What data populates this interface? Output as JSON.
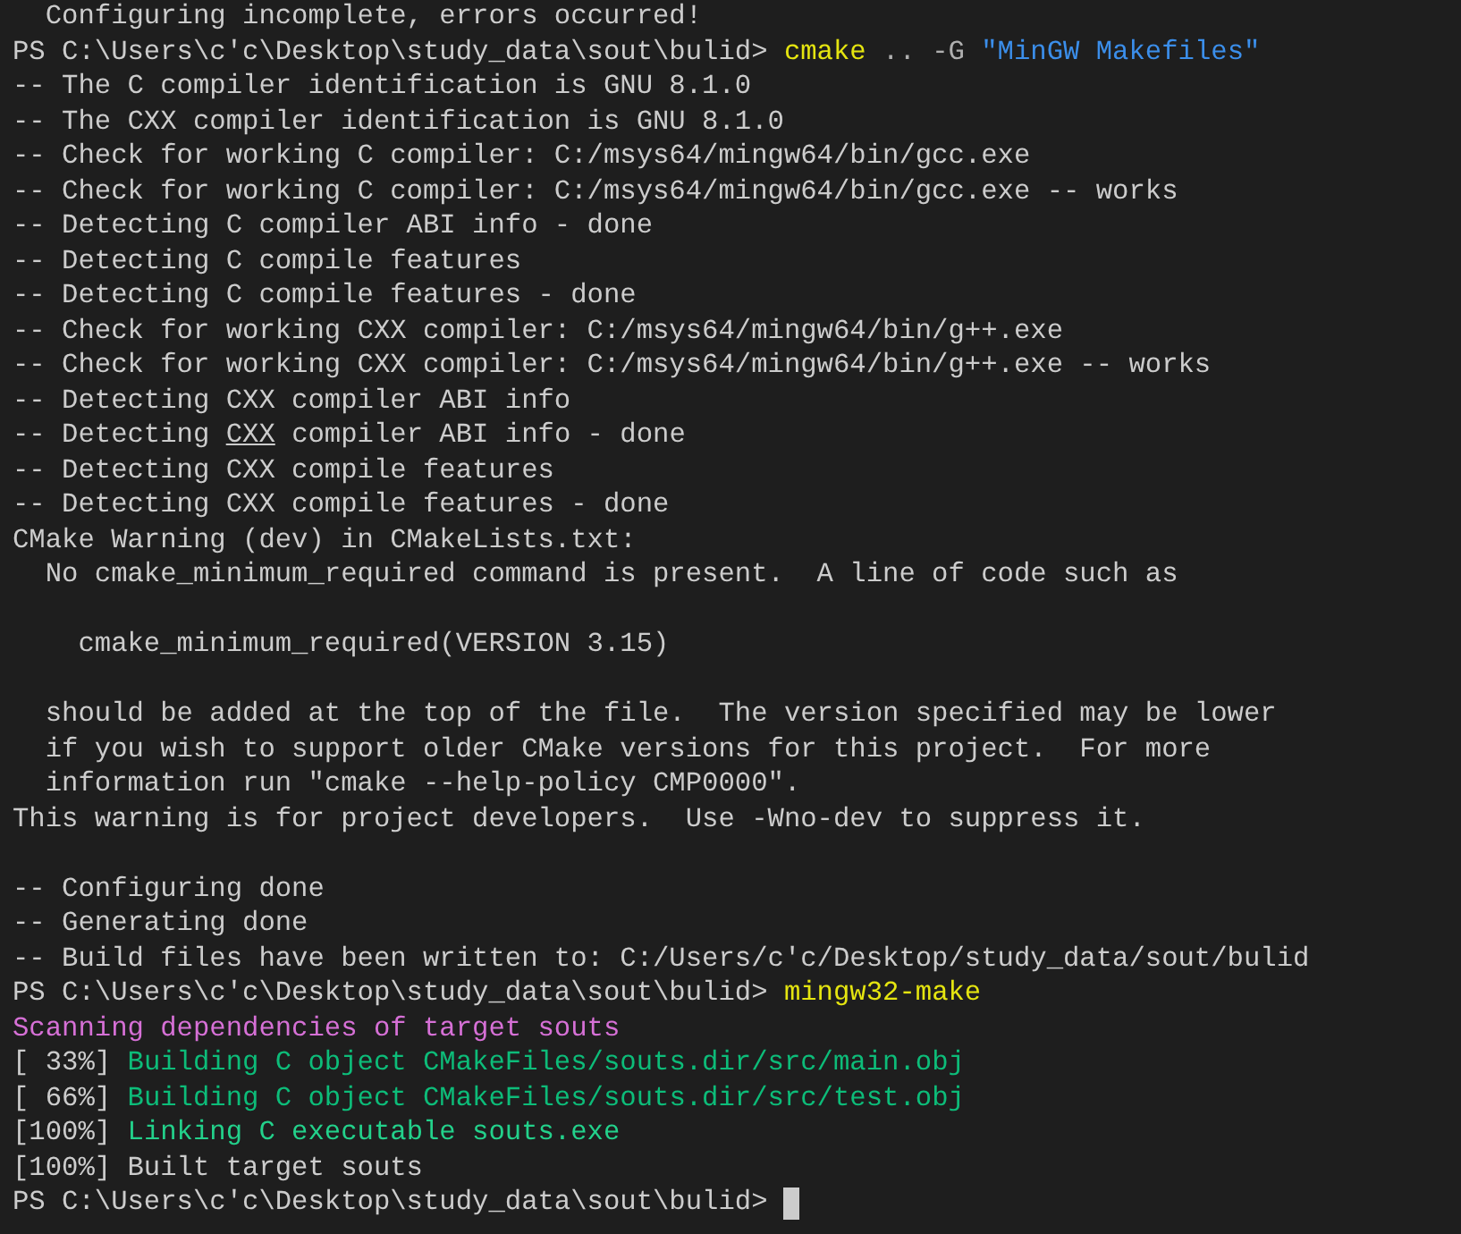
{
  "terminal": {
    "lines": [
      {
        "kind": "text",
        "segments": [
          {
            "kind": "plain",
            "text": "  Configuring incomplete, errors occurred!"
          }
        ]
      },
      {
        "kind": "text",
        "segments": [
          {
            "kind": "plain",
            "text": "PS C:\\Users\\c'c\\Desktop\\study_data\\sout\\bulid> "
          },
          {
            "kind": "command",
            "text": "cmake"
          },
          {
            "kind": "arg",
            "text": " .. -G "
          },
          {
            "kind": "string",
            "text": "\"MinGW Makefiles\""
          }
        ]
      },
      {
        "kind": "text",
        "segments": [
          {
            "kind": "plain",
            "text": "-- The C compiler identification is GNU 8.1.0"
          }
        ]
      },
      {
        "kind": "text",
        "segments": [
          {
            "kind": "plain",
            "text": "-- The CXX compiler identification is GNU 8.1.0"
          }
        ]
      },
      {
        "kind": "text",
        "segments": [
          {
            "kind": "plain",
            "text": "-- Check for working C compiler: C:/msys64/mingw64/bin/gcc.exe"
          }
        ]
      },
      {
        "kind": "text",
        "segments": [
          {
            "kind": "plain",
            "text": "-- Check for working C compiler: C:/msys64/mingw64/bin/gcc.exe -- works"
          }
        ]
      },
      {
        "kind": "text",
        "segments": [
          {
            "kind": "plain",
            "text": "-- Detecting C compiler ABI info - done"
          }
        ]
      },
      {
        "kind": "text",
        "segments": [
          {
            "kind": "plain",
            "text": "-- Detecting C compile features"
          }
        ]
      },
      {
        "kind": "text",
        "segments": [
          {
            "kind": "plain",
            "text": "-- Detecting C compile features - done"
          }
        ]
      },
      {
        "kind": "text",
        "segments": [
          {
            "kind": "plain",
            "text": "-- Check for working CXX compiler: C:/msys64/mingw64/bin/g++.exe"
          }
        ]
      },
      {
        "kind": "text",
        "segments": [
          {
            "kind": "plain",
            "text": "-- Check for working CXX compiler: C:/msys64/mingw64/bin/g++.exe -- works"
          }
        ]
      },
      {
        "kind": "text",
        "segments": [
          {
            "kind": "plain",
            "text": "-- Detecting CXX compiler ABI info"
          }
        ]
      },
      {
        "kind": "text",
        "segments": [
          {
            "kind": "plain",
            "text": "-- Detecting "
          },
          {
            "kind": "underline",
            "text": "CXX"
          },
          {
            "kind": "plain",
            "text": " compiler ABI info - done"
          }
        ]
      },
      {
        "kind": "text",
        "segments": [
          {
            "kind": "plain",
            "text": "-- Detecting CXX compile features"
          }
        ]
      },
      {
        "kind": "text",
        "segments": [
          {
            "kind": "plain",
            "text": "-- Detecting CXX compile features - done"
          }
        ]
      },
      {
        "kind": "text",
        "segments": [
          {
            "kind": "plain",
            "text": "CMake Warning (dev) in CMakeLists.txt:"
          }
        ]
      },
      {
        "kind": "text",
        "segments": [
          {
            "kind": "plain",
            "text": "  No cmake_minimum_required command is present.  A line of code such as"
          }
        ]
      },
      {
        "kind": "blank"
      },
      {
        "kind": "text",
        "segments": [
          {
            "kind": "plain",
            "text": "    cmake_minimum_required(VERSION 3.15)"
          }
        ]
      },
      {
        "kind": "blank"
      },
      {
        "kind": "text",
        "segments": [
          {
            "kind": "plain",
            "text": "  should be added at the top of the file.  The version specified may be lower"
          }
        ]
      },
      {
        "kind": "text",
        "segments": [
          {
            "kind": "plain",
            "text": "  if you wish to support older CMake versions for this project.  For more"
          }
        ]
      },
      {
        "kind": "text",
        "segments": [
          {
            "kind": "plain",
            "text": "  information run \"cmake --help-policy CMP0000\"."
          }
        ]
      },
      {
        "kind": "text",
        "segments": [
          {
            "kind": "plain",
            "text": "This warning is for project developers.  Use -Wno-dev to suppress it."
          }
        ]
      },
      {
        "kind": "blank"
      },
      {
        "kind": "text",
        "segments": [
          {
            "kind": "plain",
            "text": "-- Configuring done"
          }
        ]
      },
      {
        "kind": "text",
        "segments": [
          {
            "kind": "plain",
            "text": "-- Generating done"
          }
        ]
      },
      {
        "kind": "text",
        "segments": [
          {
            "kind": "plain",
            "text": "-- Build files have been written to: C:/Users/c'c/Desktop/study_data/sout/bulid"
          }
        ]
      },
      {
        "kind": "text",
        "segments": [
          {
            "kind": "plain",
            "text": "PS C:\\Users\\c'c\\Desktop\\study_data\\sout\\bulid> "
          },
          {
            "kind": "command",
            "text": "mingw32-make"
          }
        ]
      },
      {
        "kind": "text",
        "segments": [
          {
            "kind": "magenta",
            "text": "Scanning dependencies of target souts"
          }
        ]
      },
      {
        "kind": "text",
        "segments": [
          {
            "kind": "plain",
            "text": "[ 33%] "
          },
          {
            "kind": "green",
            "text": "Building C object CMakeFiles/souts.dir/src/main.obj"
          }
        ]
      },
      {
        "kind": "text",
        "segments": [
          {
            "kind": "plain",
            "text": "[ 66%] "
          },
          {
            "kind": "green",
            "text": "Building C object CMakeFiles/souts.dir/src/test.obj"
          }
        ]
      },
      {
        "kind": "text",
        "segments": [
          {
            "kind": "plain",
            "text": "[100%] "
          },
          {
            "kind": "bright-green",
            "text": "Linking C executable souts.exe"
          }
        ]
      },
      {
        "kind": "text",
        "segments": [
          {
            "kind": "plain",
            "text": "[100%] Built target souts"
          }
        ]
      },
      {
        "kind": "text",
        "cursor": true,
        "segments": [
          {
            "kind": "plain",
            "text": "PS C:\\Users\\c'c\\Desktop\\study_data\\sout\\bulid> "
          }
        ]
      }
    ]
  }
}
